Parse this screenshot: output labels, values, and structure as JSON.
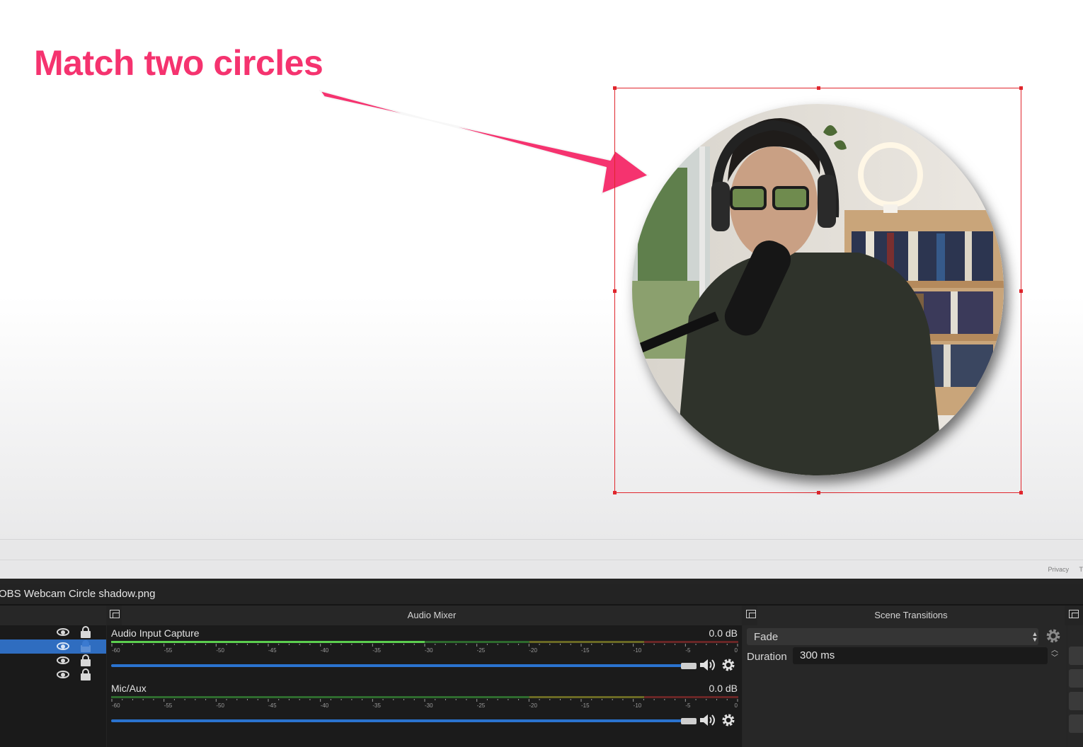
{
  "annotation": {
    "text": "Match two circles"
  },
  "obs": {
    "title": "OBS Webcam Circle shadow.png",
    "footer_link": "Privacy",
    "footer_link_rest": "T"
  },
  "sources": {
    "rows": [
      {
        "visible": true,
        "locked": true,
        "selected": false
      },
      {
        "visible": true,
        "locked": true,
        "selected": true
      },
      {
        "visible": true,
        "locked": true,
        "selected": false
      },
      {
        "visible": true,
        "locked": true,
        "selected": false
      }
    ]
  },
  "audio_mixer": {
    "title": "Audio Mixer",
    "scale_labels": [
      "-60",
      "-55",
      "-50",
      "-45",
      "-40",
      "-35",
      "-30",
      "-25",
      "-20",
      "-15",
      "-10",
      "-5",
      "0"
    ],
    "channels": [
      {
        "name": "Audio Input Capture",
        "level": "0.0 dB",
        "volume_fraction": 0.95,
        "meter_peak_fraction": 0.5
      },
      {
        "name": "Mic/Aux",
        "level": "0.0 dB",
        "volume_fraction": 0.95,
        "meter_peak_fraction": 0
      }
    ]
  },
  "scene_transitions": {
    "title": "Scene Transitions",
    "transition": "Fade",
    "duration_label": "Duration",
    "duration_value": "300 ms"
  },
  "colors": {
    "annotation": "#f5336f",
    "selection": "#e0262d",
    "source_selected": "#2f6dc0",
    "volume_track": "#2a73cf"
  },
  "icons": [
    "arrow-annotation",
    "eye-icon",
    "lock-icon",
    "dock-float-icon",
    "speaker-icon",
    "gear-icon",
    "chevron-updown-icon"
  ]
}
